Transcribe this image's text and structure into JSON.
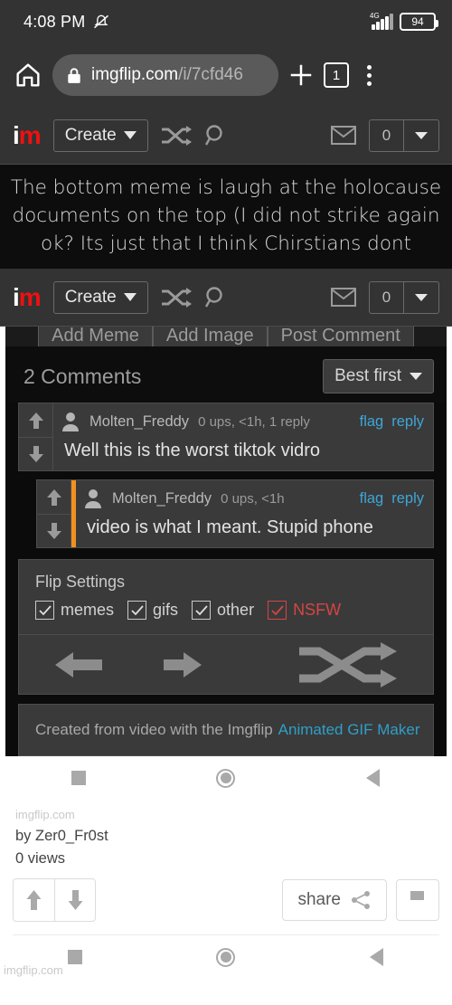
{
  "statusbar": {
    "time": "4:08 PM",
    "mute_icon": "bell-muted-icon",
    "network_label": "4G",
    "battery_level": "94"
  },
  "browser": {
    "home_icon": "home-icon",
    "lock_icon": "lock-icon",
    "url_domain": "imgflip.com",
    "url_path": "/i/7cfd46",
    "new_tab_icon": "plus-icon",
    "tab_count": "1",
    "menu_icon": "kebab-menu-icon"
  },
  "site_header": {
    "logo_i": "i",
    "logo_m": "m",
    "create_label": "Create",
    "shuffle_icon": "shuffle-icon",
    "search_icon": "search-icon",
    "messages_icon": "envelope-icon",
    "notification_count": "0",
    "dropdown_icon": "chevron-down-icon"
  },
  "meme_caption": [
    "The bottom meme is laugh at the holocause",
    "documents on the top (I did not strike again",
    "ok? Its just that I think Chirstians dont"
  ],
  "nested_screenshot": {
    "site_header": {
      "logo_i": "i",
      "logo_m": "m",
      "create_label": "Create",
      "notification_count": "0"
    },
    "action_buttons": [
      "Add Meme",
      "Add Image",
      "Post Comment"
    ],
    "comments_heading": "2 Comments",
    "sort_label": "Best first",
    "comments": [
      {
        "username": "Molten_Freddy",
        "meta": "0 ups, <1h, 1 reply",
        "flag_label": "flag",
        "reply_label": "reply",
        "text": "Well this is the worst tiktok vidro",
        "is_reply": false
      },
      {
        "username": "Molten_Freddy",
        "meta": "0 ups, <1h",
        "flag_label": "flag",
        "reply_label": "reply",
        "text": "video is what I meant. Stupid phone",
        "is_reply": true
      }
    ],
    "flip_settings": {
      "title": "Flip Settings",
      "options": [
        {
          "label": "memes",
          "checked": true,
          "nsfw": false
        },
        {
          "label": "gifs",
          "checked": true,
          "nsfw": false
        },
        {
          "label": "other",
          "checked": true,
          "nsfw": false
        },
        {
          "label": "NSFW",
          "checked": true,
          "nsfw": true
        }
      ]
    },
    "nav": {
      "prev_icon": "arrow-left-icon",
      "next_icon": "arrow-right-icon",
      "shuffle_icon": "shuffle-icon"
    },
    "credit": {
      "text": "Created from video with the Imgflip",
      "link": "Animated GIF Maker"
    },
    "android_nav": {
      "recents_icon": "square-icon",
      "home_icon": "circle-icon",
      "back_icon": "triangle-back-icon"
    }
  },
  "footer": {
    "watermark": "imgflip.com",
    "byline": "by Zer0_Fr0st",
    "views": "0 views",
    "upvote_icon": "arrow-up-icon",
    "downvote_icon": "arrow-down-icon",
    "share_label": "share",
    "share_icon": "share-icon",
    "flag_icon": "flag-icon"
  },
  "android_nav": {
    "recents_icon": "square-icon",
    "home_icon": "circle-icon",
    "back_icon": "triangle-back-icon",
    "watermark": "imgflip.com"
  },
  "colors": {
    "chrome_bar": "#333333",
    "brand_red": "#ee1111",
    "link_blue": "#3ea6d8",
    "nsfw_red": "#d64545",
    "reply_orange": "#f2911f"
  }
}
